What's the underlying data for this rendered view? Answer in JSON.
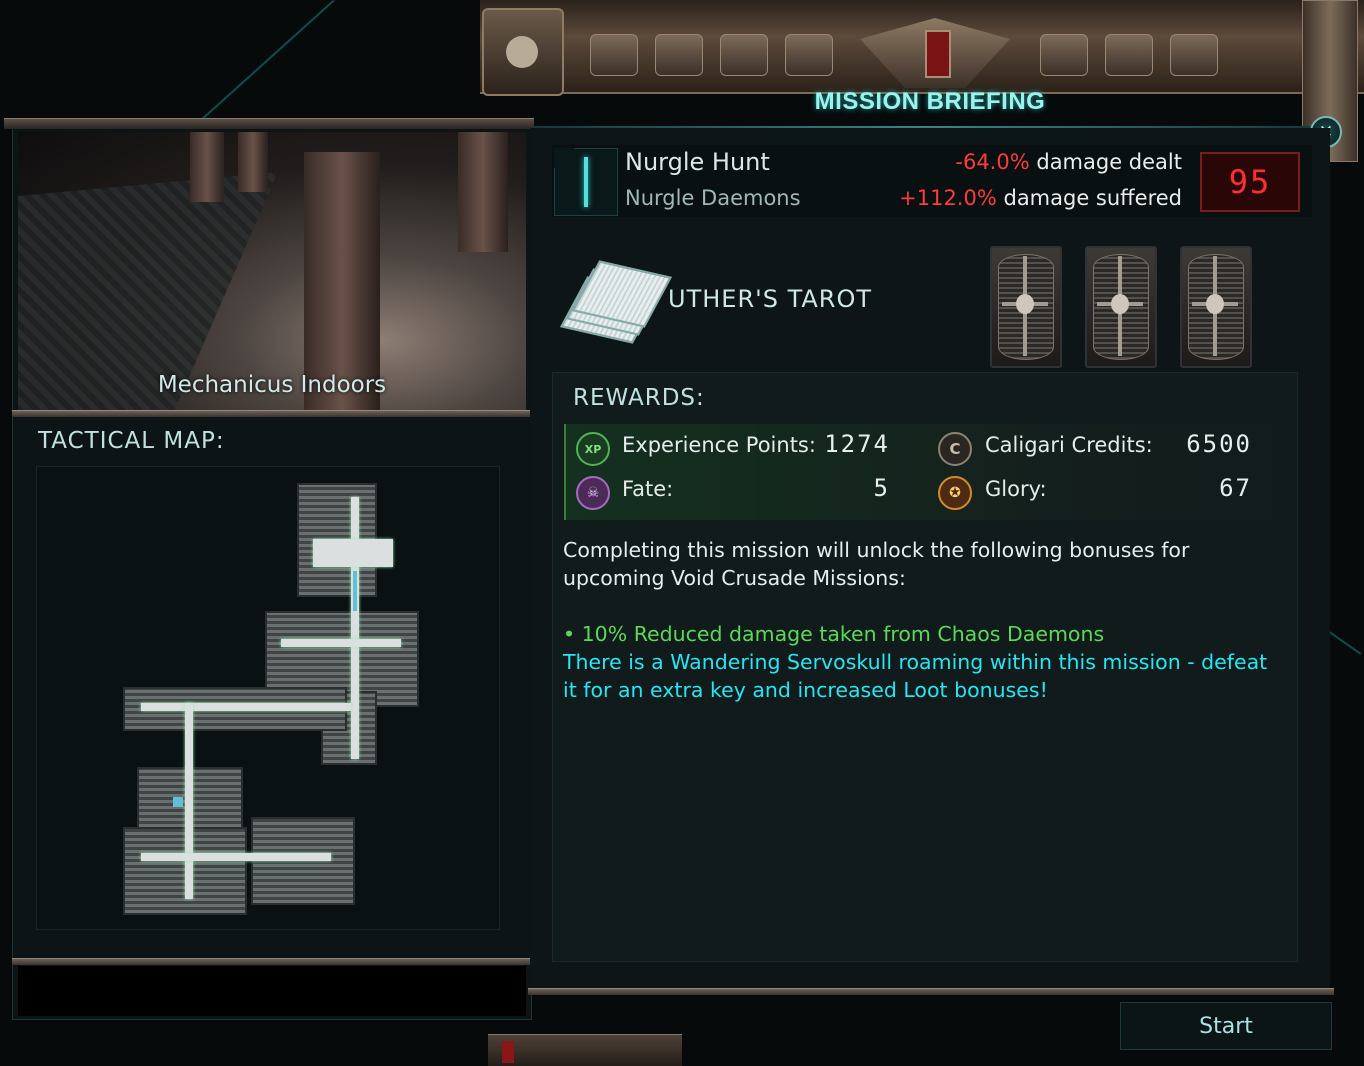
{
  "window": {
    "title": "MISSION BRIEFING"
  },
  "location": {
    "name": "Mechanicus Indoors",
    "tactical_label": "TACTICAL MAP:"
  },
  "mission": {
    "name": "Nurgle Hunt",
    "enemy": "Nurgle Daemons",
    "mod_dealt_value": "-64.0%",
    "mod_dealt_text": "damage dealt",
    "mod_suffered_value": "+112.0%",
    "mod_suffered_text": "damage suffered",
    "threat_level": "95",
    "icon": "nurgle-staff-icon"
  },
  "tarot": {
    "label": "UTHER'S TAROT",
    "cards": [
      {
        "icon": "tarot-card-back-icon"
      },
      {
        "icon": "tarot-card-back-icon"
      },
      {
        "icon": "tarot-card-back-icon"
      }
    ]
  },
  "rewards": {
    "title": "REWARDS:",
    "items": [
      {
        "label": "Experience Points:",
        "value": "1274",
        "icon": "xp-icon",
        "icon_text": "XP"
      },
      {
        "label": "Caligari Credits:",
        "value": "6500",
        "icon": "credits-icon",
        "icon_text": "C"
      },
      {
        "label": "Fate:",
        "value": "5",
        "icon": "fate-skull-icon",
        "icon_text": "☠"
      },
      {
        "label": "Glory:",
        "value": "67",
        "icon": "glory-medal-icon",
        "icon_text": "✪"
      }
    ]
  },
  "description": {
    "intro": "Completing this mission will unlock the following bonuses for upcoming Void Crusade Missions:",
    "bonus": "• 10% Reduced damage taken from Chaos Daemons",
    "servoskull": "There is a Wandering Servoskull roaming within this mission - defeat it for an extra key and increased Loot bonuses!"
  },
  "actions": {
    "start_label": "Start",
    "close_glyph": "✕"
  },
  "colors": {
    "accent_cyan": "#9ef2ee",
    "penalty_red": "#ff3a3a",
    "bonus_green": "#59d957",
    "servo_cyan": "#25e6f2"
  }
}
